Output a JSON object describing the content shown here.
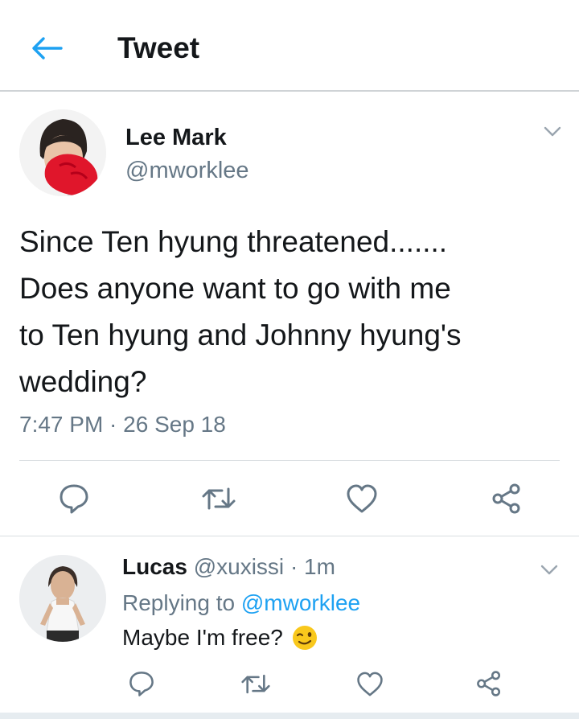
{
  "header": {
    "title": "Tweet",
    "back_icon": "arrow-left-icon",
    "accent": "#1da1f2"
  },
  "tweet": {
    "author_name": "Lee Mark",
    "author_handle": "@mworklee",
    "text": "Since Ten hyung threatened.......\nDoes anyone want to go with me\nto Ten hyung and Johnny hyung's\nwedding?",
    "timestamp": "7:47 PM · 26 Sep 18",
    "actions": [
      "reply-icon",
      "retweet-icon",
      "like-icon",
      "share-icon"
    ]
  },
  "reply": {
    "author_name": "Lucas",
    "author_handle": "@xuxissi",
    "separator": "·",
    "time_ago": "1m",
    "replying_prefix": "Replying to",
    "replying_handle": "@mworklee",
    "text": "Maybe I'm free?",
    "emoji": "winking-face-emoji"
  },
  "colors": {
    "text": "#14171a",
    "muted": "#657786",
    "link": "#1da1f2",
    "icon": "#657786"
  }
}
